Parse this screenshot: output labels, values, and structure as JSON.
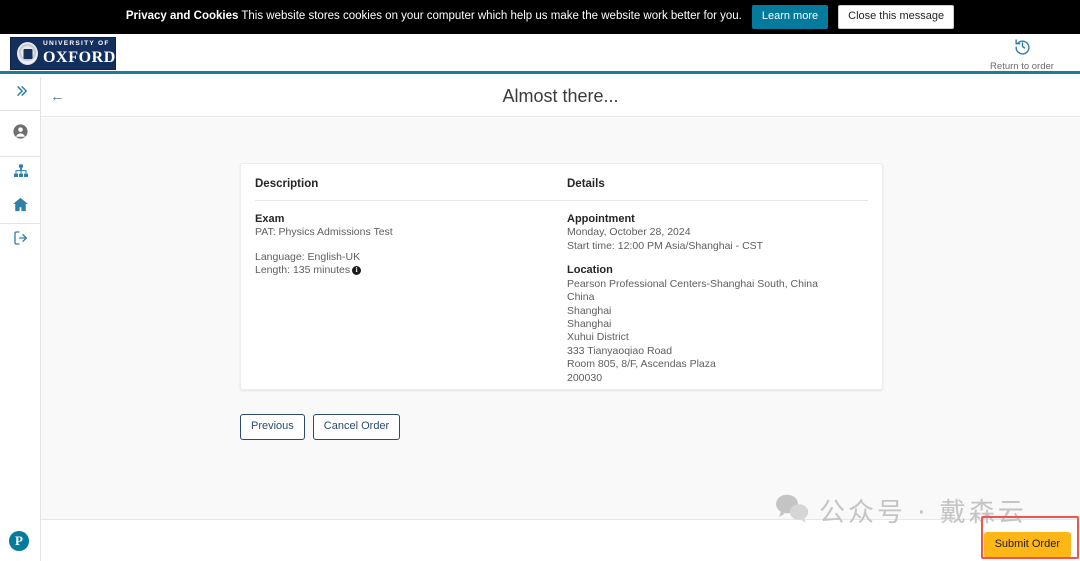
{
  "cookie_banner": {
    "title": "Privacy and Cookies",
    "message": "This website stores cookies on your computer which help us make the website work better for you.",
    "learn_more_label": "Learn more",
    "close_label": "Close this message",
    "learn_more_color": "#047a9c",
    "background_color": "#000000"
  },
  "header": {
    "logo_university": "UNIVERSITY OF",
    "logo_name": "OXFORD",
    "logo_background": "#132f5d",
    "accent_color": "#1c7b9c",
    "return_to_order": {
      "icon": "history-clock-icon",
      "label": "Return to order"
    }
  },
  "sidebar": {
    "items": [
      {
        "icon": "double-chevron-right-icon",
        "name": "expand-sidebar"
      },
      {
        "icon": "account-person-icon",
        "name": "account"
      },
      {
        "icon": "sitemap-icon",
        "name": "organization"
      },
      {
        "icon": "home-icon",
        "name": "home"
      },
      {
        "icon": "logout-icon",
        "name": "sign-out"
      }
    ],
    "brand_logo": {
      "icon": "pearson-logo-icon",
      "letter": "P",
      "color": "#047a9c"
    }
  },
  "page": {
    "back_icon": "arrow-left-icon",
    "title": "Almost there..."
  },
  "card": {
    "columns": [
      "Description",
      "Details"
    ],
    "description": {
      "exam_title": "Exam",
      "exam_name": "PAT: Physics Admissions Test",
      "language": "Language: English-UK",
      "length": "Length: 135 minutes",
      "length_info_icon": "info-icon"
    },
    "details": {
      "appointment_title": "Appointment",
      "appointment_date": "Monday, October 28, 2024",
      "appointment_time": "Start time: 12:00 PM Asia/Shanghai - CST",
      "location_title": "Location",
      "location_lines": [
        "Pearson Professional Centers-Shanghai South, China",
        "China",
        "Shanghai",
        "Shanghai",
        "Xuhui District",
        "333 Tianyaoqiao Road",
        "Room 805, 8/F, Ascendas Plaza",
        "200030"
      ]
    }
  },
  "actions": {
    "previous_label": "Previous",
    "cancel_order_label": "Cancel Order",
    "submit_order_label": "Submit Order",
    "submit_order_color": "#ffb718",
    "highlight_color": "#f0544f"
  },
  "watermark": {
    "icon": "wechat-icon",
    "text": "公众号 · 戴森云"
  }
}
